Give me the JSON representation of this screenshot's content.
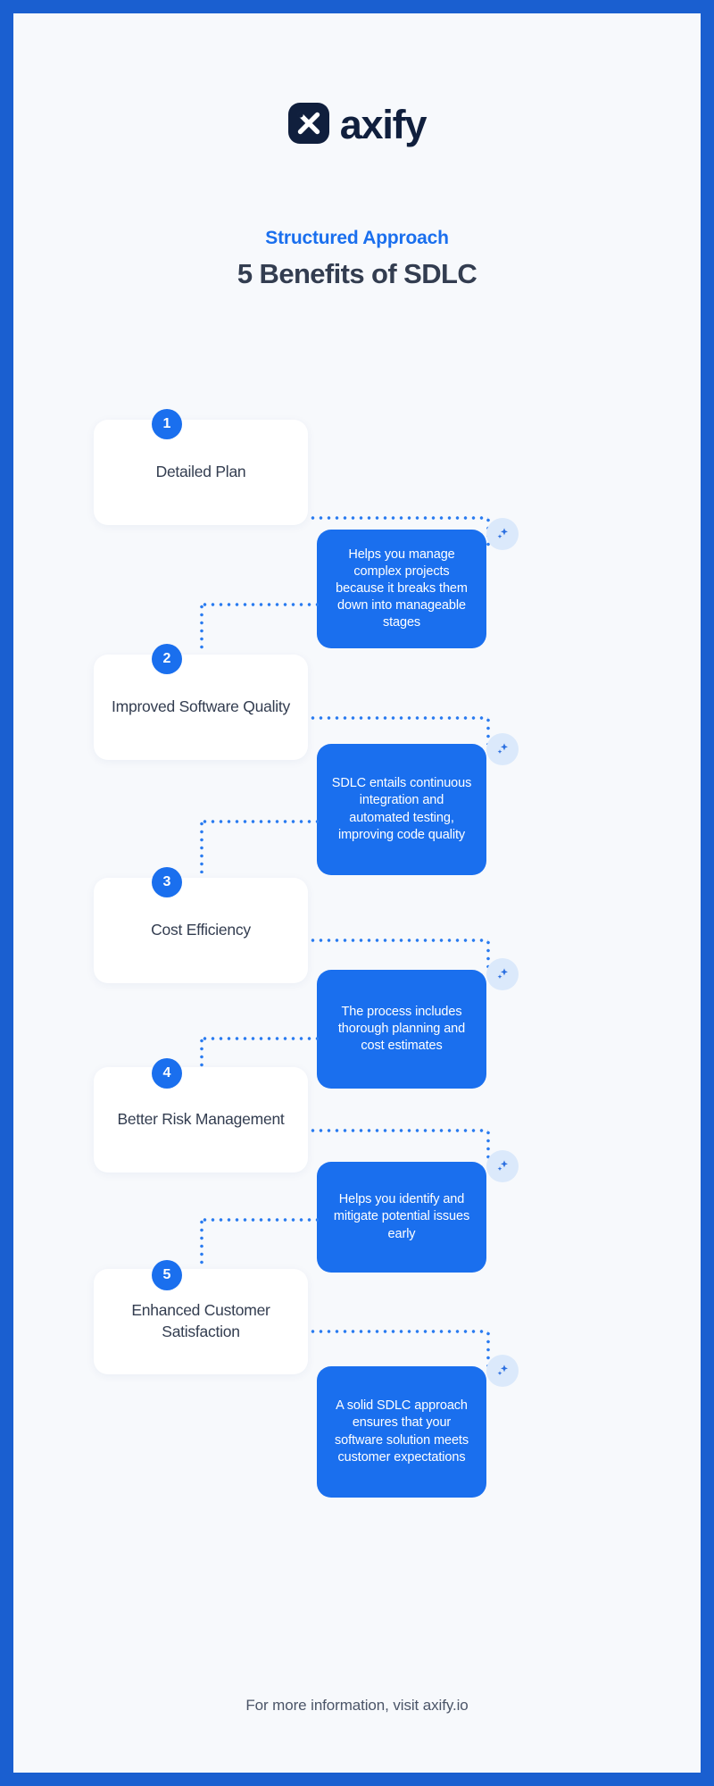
{
  "brand": {
    "name": "axify",
    "logo_icon": "axify-x-mark-icon",
    "logo_bg": "#101f3d"
  },
  "header": {
    "eyebrow": "Structured Approach",
    "headline": "5 Benefits of SDLC"
  },
  "colors": {
    "frame_blue": "#1a5fd0",
    "accent_blue": "#1a6fee",
    "canvas": "#f7f9fc",
    "dark_text": "#333d50",
    "sparkle_bg": "#dbe9fb"
  },
  "steps": [
    {
      "number": "1",
      "title": "Detailed Plan",
      "detail": "Helps you manage complex projects because it breaks them down into manageable stages",
      "icon": "sparkle-icon"
    },
    {
      "number": "2",
      "title": "Improved Software Quality",
      "detail": "SDLC entails continuous integration and automated testing, improving code quality",
      "icon": "sparkle-icon"
    },
    {
      "number": "3",
      "title": "Cost Efficiency",
      "detail": "The process includes thorough planning and cost estimates",
      "icon": "sparkle-icon"
    },
    {
      "number": "4",
      "title": "Better Risk Management",
      "detail": "Helps you identify and mitigate potential issues early",
      "icon": "sparkle-icon"
    },
    {
      "number": "5",
      "title": "Enhanced Customer Satisfaction",
      "detail": "A solid SDLC approach ensures that your software solution meets customer expectations",
      "icon": "sparkle-icon"
    }
  ],
  "footer": {
    "text": "For more information, visit axify.io"
  }
}
